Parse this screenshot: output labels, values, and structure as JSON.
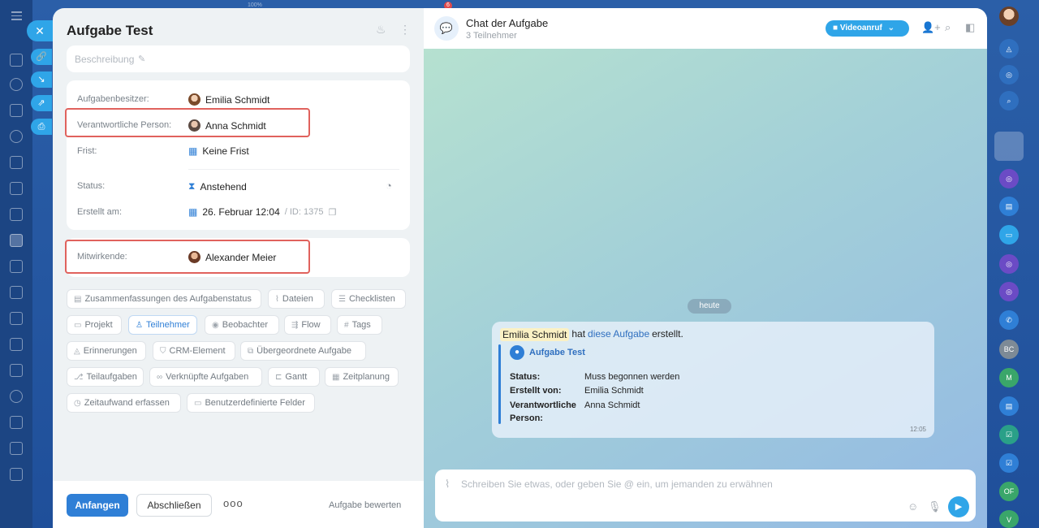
{
  "task": {
    "title": "Aufgabe Test",
    "description_placeholder": "Beschreibung",
    "owner_label": "Aufgabenbesitzer:",
    "owner": "Emilia Schmidt",
    "responsible_label": "Verantwortliche Person:",
    "responsible": "Anna Schmidt",
    "deadline_label": "Frist:",
    "deadline": "Keine Frist",
    "status_label": "Status:",
    "status": "Anstehend",
    "created_label": "Erstellt am:",
    "created": "26. Februar 12:04",
    "id": "/ ID: 1375",
    "participants_label": "Mitwirkende:",
    "participant": "Alexander Meier"
  },
  "chips": [
    "Zusammenfassungen des Aufgabenstatus",
    "Dateien",
    "Checklisten",
    "Projekt",
    "Teilnehmer",
    "Beobachter",
    "Flow",
    "Tags",
    "Erinnerungen",
    "CRM-Element",
    "Übergeordnete Aufgabe",
    "Teilaufgaben",
    "Verknüpfte Aufgaben",
    "Gantt",
    "Zeitplanung",
    "Zeitaufwand erfassen",
    "Benutzerdefinierte Felder"
  ],
  "footer": {
    "start": "Anfangen",
    "finish": "Abschließen",
    "more": "ooo",
    "rate": "Aufgabe bewerten"
  },
  "chat": {
    "title": "Chat der Aufgabe",
    "subtitle": "3 Teilnehmer",
    "video": "Videoanruf",
    "date_divider": "heute",
    "msg_name": "Emilia Schmidt",
    "msg_mid": "hat",
    "msg_link": "diese Aufgabe",
    "msg_end": "erstellt.",
    "quote_title": "Aufgabe Test",
    "q_status_label": "Status:",
    "q_status": "Muss begonnen werden",
    "q_by_label": "Erstellt von:",
    "q_by": "Emilia Schmidt",
    "q_resp_label1": "Verantwortliche",
    "q_resp_label2": "Person:",
    "q_resp": "Anna Schmidt",
    "time": "12:05",
    "composer_placeholder": "Schreiben Sie etwas, oder geben Sie @ ein, um jemanden zu erwähnen"
  },
  "rail": {
    "bc": "BC",
    "m": "M",
    "of": "OF",
    "v": "V",
    "badge": "6",
    "hint": "100%"
  },
  "colors": {
    "accent": "#2f7fd6",
    "highlight_box": "#e0625d"
  }
}
